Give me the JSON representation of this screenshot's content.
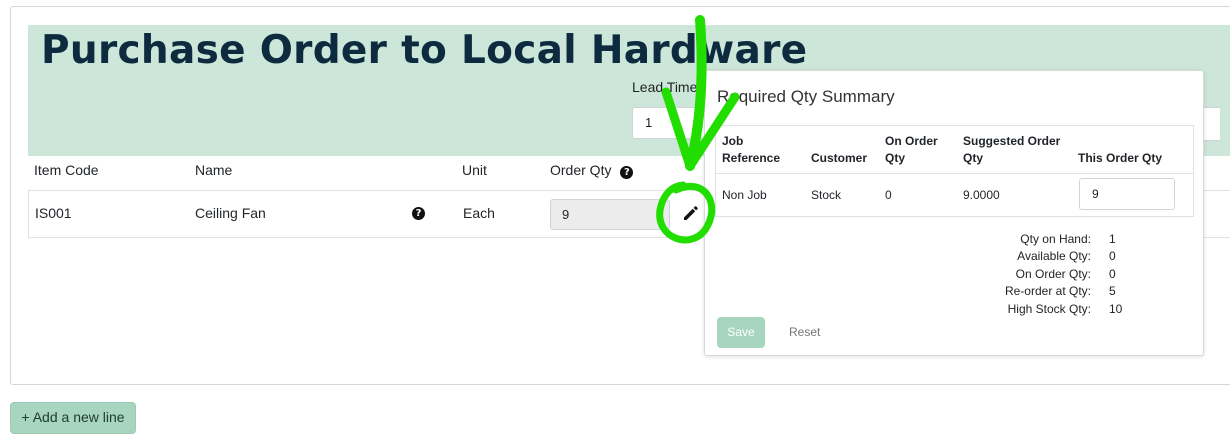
{
  "page": {
    "title": "Purchase Order to Local Hardware",
    "lead_time_label": "Lead Time",
    "lead_time_value": "1"
  },
  "table": {
    "columns": [
      "Item Code",
      "Name",
      "Unit",
      "Order Qty"
    ],
    "rows": [
      {
        "item_code": "IS001",
        "name": "Ceiling Fan",
        "unit": "Each",
        "order_qty": "9"
      }
    ]
  },
  "summary": {
    "title": "Required Qty Summary",
    "headers": {
      "job_reference": "Job\nReference",
      "customer": "Customer",
      "on_order_qty": "On Order\nQty",
      "suggested_order_qty": "Suggested Order\nQty",
      "this_order_qty": "This Order Qty"
    },
    "row": {
      "job_reference": "Non Job",
      "customer": "Stock",
      "on_order_qty": "0",
      "suggested_order_qty": "9.0000",
      "this_order_qty": "9"
    },
    "stats": [
      {
        "label": "Qty on Hand:",
        "value": "1"
      },
      {
        "label": "Available Qty:",
        "value": "0"
      },
      {
        "label": "On Order Qty:",
        "value": "0"
      },
      {
        "label": "Re-order at Qty:",
        "value": "5"
      },
      {
        "label": "High Stock Qty:",
        "value": "10"
      }
    ],
    "save_label": "Save",
    "reset_label": "Reset"
  },
  "footer": {
    "add_line_label": "+ Add a new line"
  },
  "icons": {
    "help": "question-circle-icon",
    "edit": "pencil-icon"
  },
  "colors": {
    "header_band": "#cce6d9",
    "title": "#0d2a3f",
    "accent_button": "#a8d5bf",
    "annotation": "#22dd00"
  }
}
